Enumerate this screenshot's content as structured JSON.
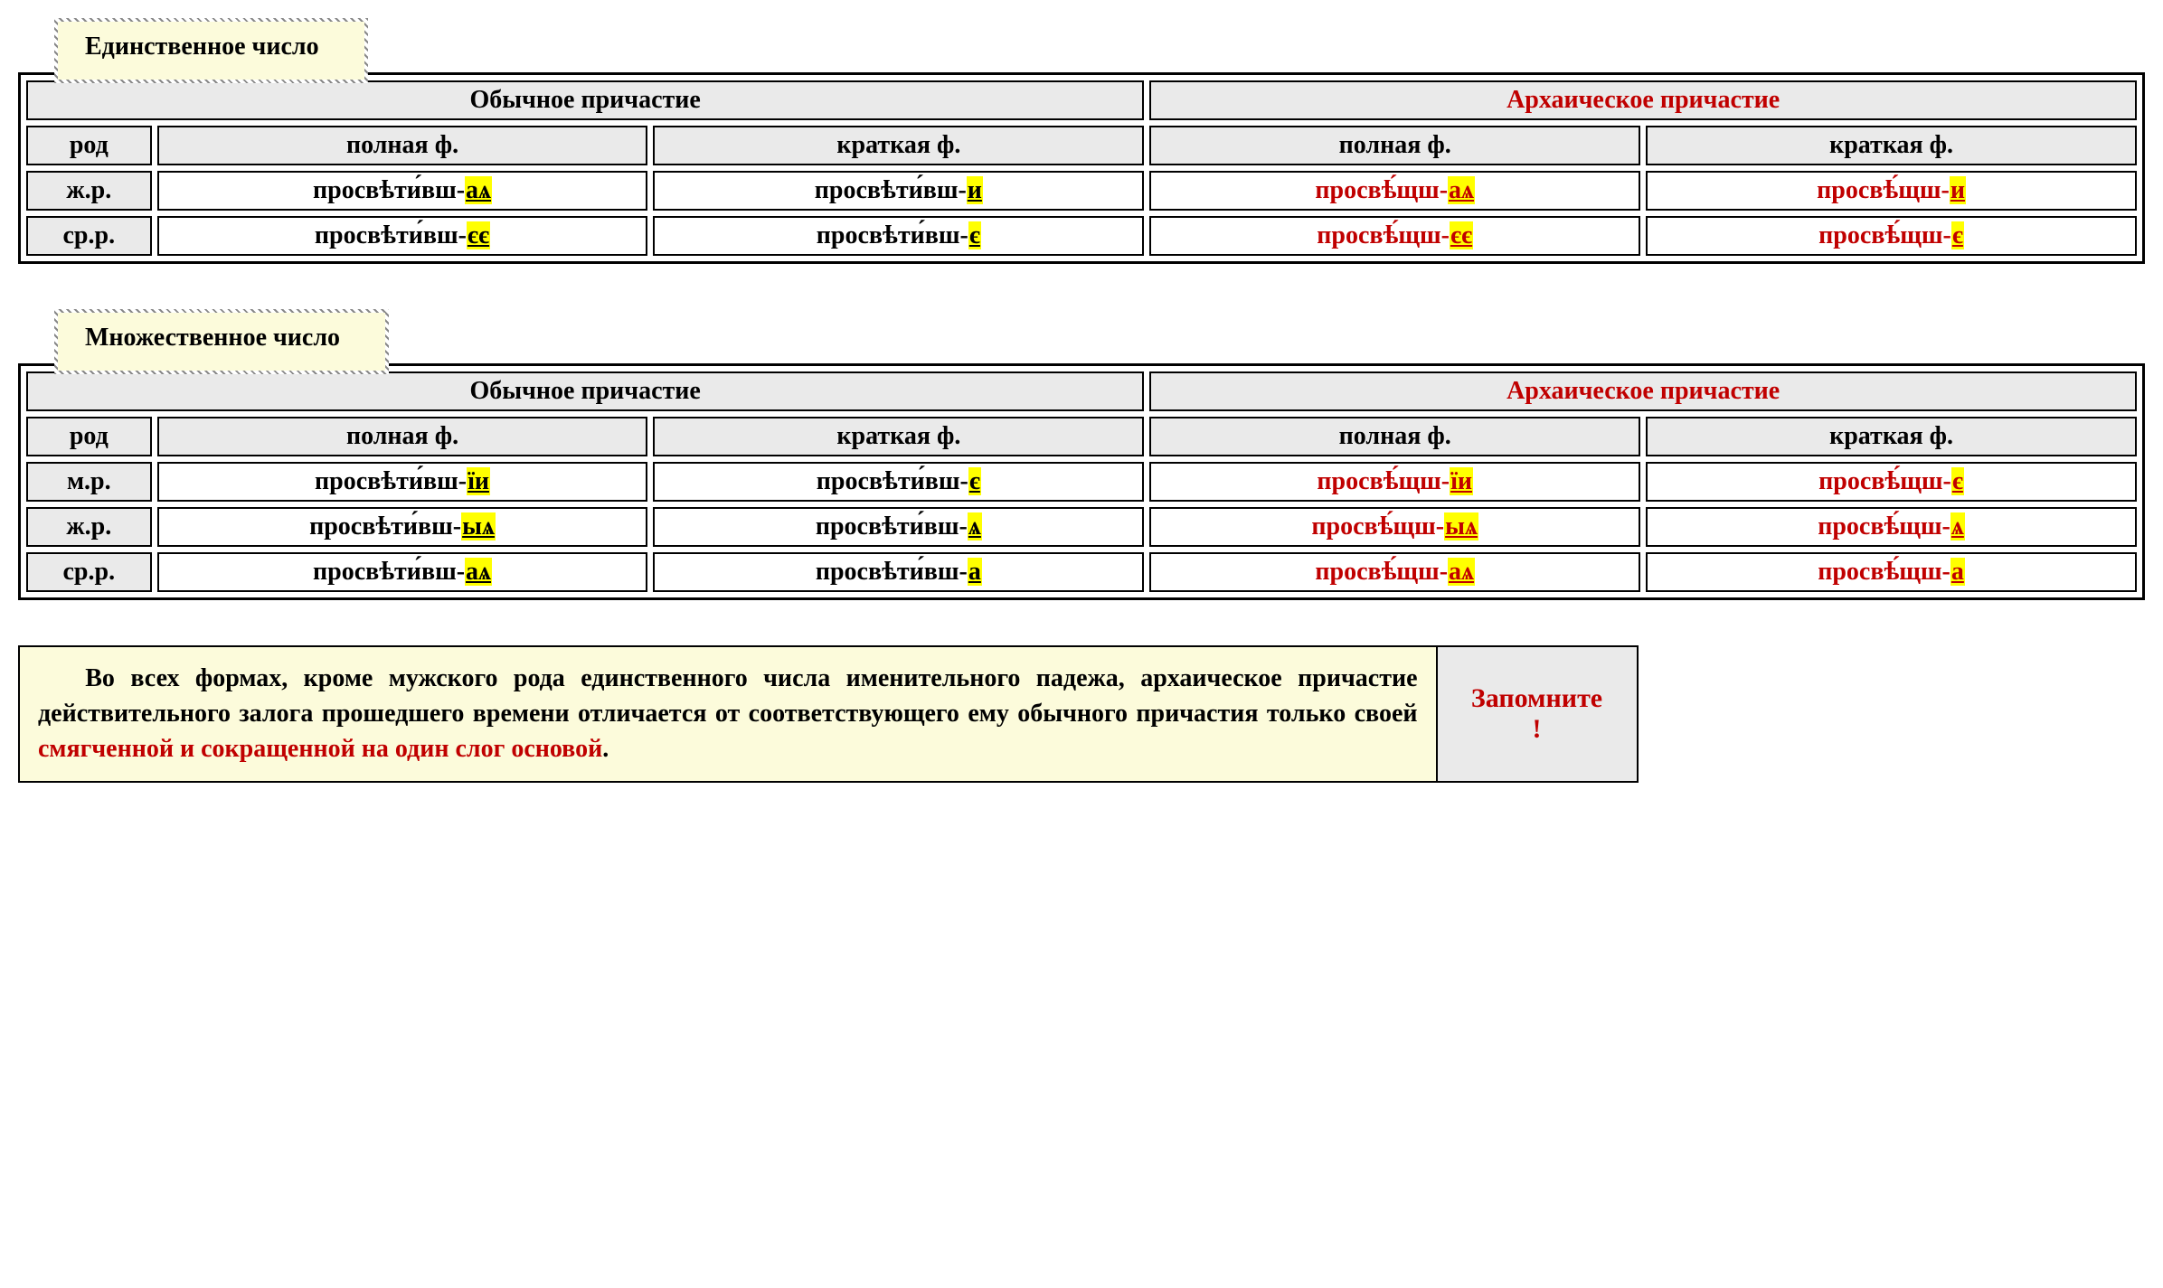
{
  "singular": {
    "title": "Единственное число",
    "h_regular": "Обычное причастие",
    "h_archaic": "Архаическое причастие",
    "h_gender": "род",
    "h_full": "полная ф.",
    "h_short": "краткая ф.",
    "rows": [
      {
        "gender": "ж.р.",
        "reg_full_stem": "просвѣти́вш-",
        "reg_full_end": "аѧ",
        "reg_short_stem": "просвѣти́вш-",
        "reg_short_end": "и",
        "arc_full_stem": "просвѣ́щш-",
        "arc_full_end": "аѧ",
        "arc_short_stem": "просвѣ́щш-",
        "arc_short_end": "и"
      },
      {
        "gender": "ср.р.",
        "reg_full_stem": "просвѣти́вш-",
        "reg_full_end": "єє",
        "reg_short_stem": "просвѣти́вш-",
        "reg_short_end": "є",
        "arc_full_stem": "просвѣ́щш-",
        "arc_full_end": "єє",
        "arc_short_stem": "просвѣ́щш-",
        "arc_short_end": "є"
      }
    ]
  },
  "plural": {
    "title": "Множественное число",
    "h_regular": "Обычное причастие",
    "h_archaic": "Архаическое причастие",
    "h_gender": "род",
    "h_full": "полная ф.",
    "h_short": "краткая ф.",
    "rows": [
      {
        "gender": "м.р.",
        "reg_full_stem": "просвѣти́вш-",
        "reg_full_end": "їи",
        "reg_short_stem": "просвѣти́вш-",
        "reg_short_end": "є",
        "arc_full_stem": "просвѣ́щш-",
        "arc_full_end": "їи",
        "arc_short_stem": "просвѣ́щш-",
        "arc_short_end": "є"
      },
      {
        "gender": "ж.р.",
        "reg_full_stem": "просвѣти́вш-",
        "reg_full_end": "ыѧ",
        "reg_short_stem": "просвѣти́вш-",
        "reg_short_end": "ѧ",
        "arc_full_stem": "просвѣ́щш-",
        "arc_full_end": "ыѧ",
        "arc_short_stem": "просвѣ́щш-",
        "arc_short_end": "ѧ"
      },
      {
        "gender": "ср.р.",
        "reg_full_stem": "просвѣти́вш-",
        "reg_full_end": "аѧ",
        "reg_short_stem": "просвѣти́вш-",
        "reg_short_end": "а",
        "arc_full_stem": "просвѣ́щш-",
        "arc_full_end": "аѧ",
        "arc_short_stem": "просвѣ́щш-",
        "arc_short_end": "а"
      }
    ]
  },
  "note": {
    "text_before": "Во всех формах, кроме мужского рода единственного числа именительного падежа, архаическое причастие действительного залога прошедшего времени отличается от соответствующего ему обычного причастия только своей ",
    "text_red": "смягченной и сокращенной на один слог основой",
    "period": ".",
    "label": "Запомните",
    "bang": "!"
  }
}
